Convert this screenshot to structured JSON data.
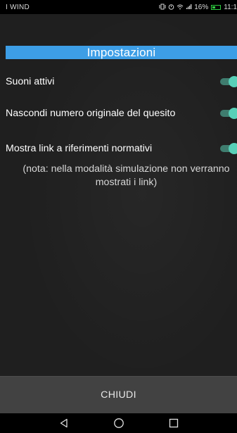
{
  "status_bar": {
    "carrier": "I WIND",
    "battery_text": "16%",
    "time": "11:1",
    "icons": [
      "vibrate-icon",
      "alarm-icon",
      "wifi-icon",
      "signal-icon",
      "battery-icon"
    ]
  },
  "screen": {
    "title": "Impostazioni",
    "settings": [
      {
        "label": "Suoni attivi",
        "enabled": true
      },
      {
        "label": "Nascondi numero originale del quesito",
        "enabled": true
      },
      {
        "label": "Mostra link a riferimenti normativi",
        "enabled": true
      }
    ],
    "note": "(nota: nella modalità simulazione non verranno mostrati i link)",
    "close_label": "CHIUDI"
  },
  "navigation": {
    "buttons": [
      "back-icon",
      "home-icon",
      "recents-icon"
    ]
  },
  "colors": {
    "title_band": "#3d9ee6",
    "toggle_thumb": "#58d0b8",
    "toggle_track": "#3f7d6f",
    "background": "#1f1f1f",
    "close_bar": "#424242"
  }
}
